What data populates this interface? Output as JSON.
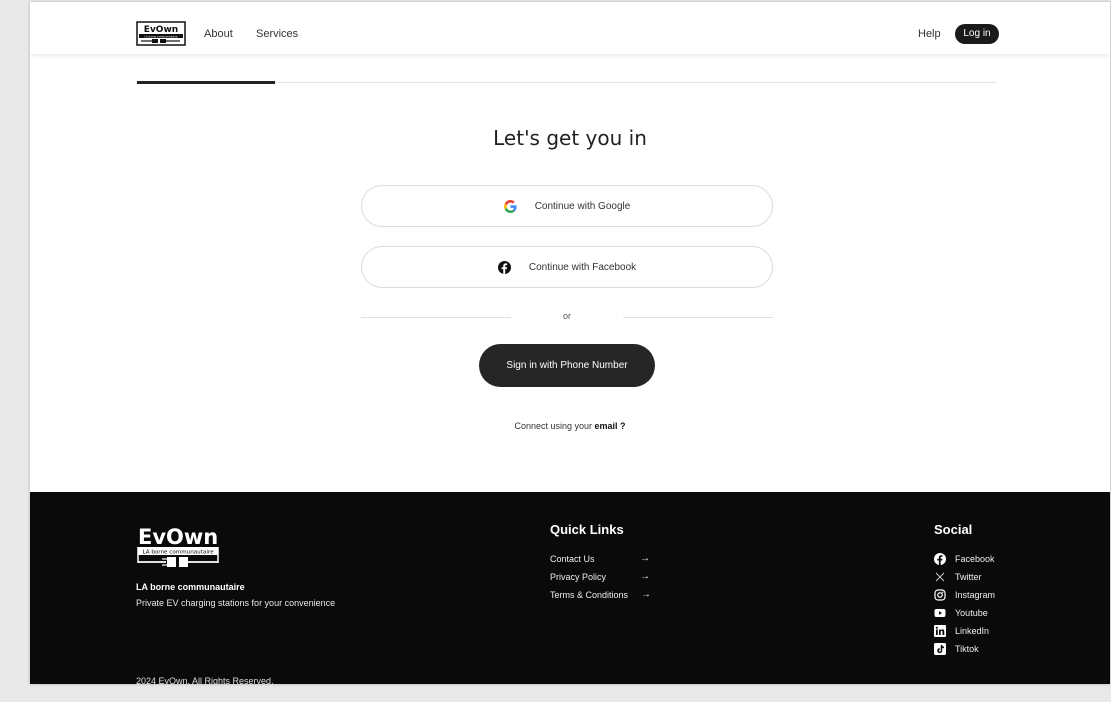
{
  "header": {
    "nav": {
      "about": "About",
      "services": "Services",
      "help": "Help"
    },
    "login_label": "Log in"
  },
  "main": {
    "title": "Let's get you in",
    "google_label": "Continue with Google",
    "facebook_label": "Continue with Facebook",
    "or_label": "or",
    "phone_label": "Sign in with Phone Number",
    "email_prefix": "Connect using your ",
    "email_link": "email ?"
  },
  "footer": {
    "tagline_title": "LA borne communautaire",
    "tagline_sub": "Private EV charging stations for your convenience",
    "copyright": "2024 EvOwn. All Rights Reserved.",
    "quick_links_title": "Quick Links",
    "quick_links": [
      {
        "label": "Contact Us",
        "arrow": "→"
      },
      {
        "label": "Privacy Policy",
        "arrow": "→"
      },
      {
        "label": "Terms & Conditions",
        "arrow": "→"
      }
    ],
    "social_title": "Social",
    "social": [
      {
        "label": "Facebook",
        "icon": "facebook-icon"
      },
      {
        "label": "Twitter",
        "icon": "x-icon"
      },
      {
        "label": "Instagram",
        "icon": "instagram-icon"
      },
      {
        "label": "Youtube",
        "icon": "youtube-icon"
      },
      {
        "label": "LinkedIn",
        "icon": "linkedin-icon"
      },
      {
        "label": "Tiktok",
        "icon": "tiktok-icon"
      }
    ]
  },
  "colors": {
    "dark": "#1a1a1a",
    "footer_bg": "#0a0a0a",
    "google_blue": "#4285F4",
    "google_red": "#EA4335",
    "google_yellow": "#FBBC05",
    "google_green": "#34A853"
  },
  "logo": {
    "wordmark": "EvOwn",
    "small_text": "LA borne communautaire"
  }
}
